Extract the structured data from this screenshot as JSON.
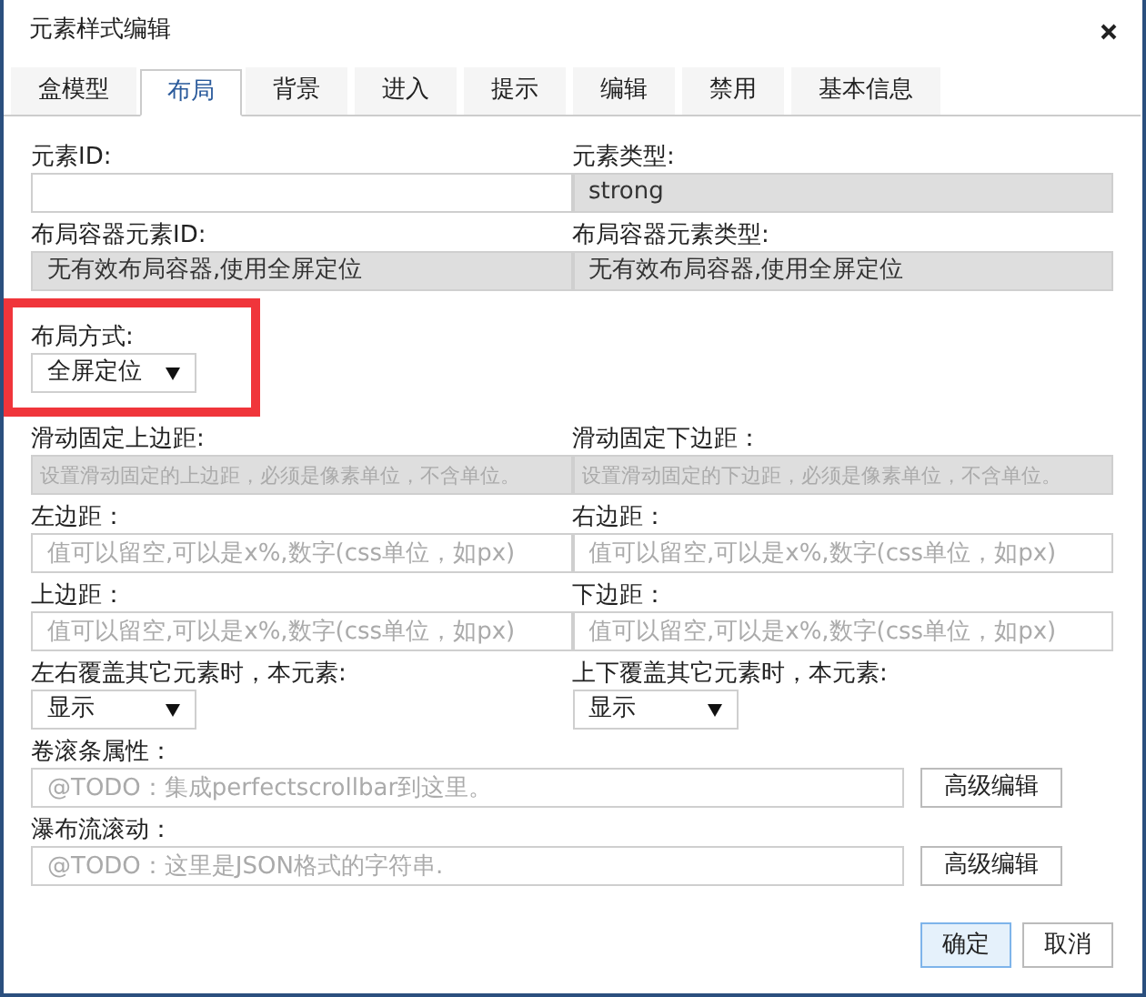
{
  "window": {
    "title": "元素样式编辑"
  },
  "tabs": [
    {
      "label": "盒模型",
      "selected": false
    },
    {
      "label": "布局",
      "selected": true
    },
    {
      "label": "背景",
      "selected": false
    },
    {
      "label": "进入",
      "selected": false
    },
    {
      "label": "提示",
      "selected": false
    },
    {
      "label": "编辑",
      "selected": false
    },
    {
      "label": "禁用",
      "selected": false
    },
    {
      "label": "基本信息",
      "selected": false
    }
  ],
  "rows": [
    {
      "kind": "pair",
      "cells": [
        {
          "label": "元素ID:",
          "kind": "input"
        },
        {
          "label": "元素类型:",
          "kind": "readonly",
          "value": "strong"
        }
      ]
    },
    {
      "kind": "pair",
      "cells": [
        {
          "label": "布局容器元素ID:",
          "kind": "readonly",
          "value": "无有效布局容器,使用全屏定位"
        },
        {
          "label": "布局容器元素类型:",
          "kind": "readonly",
          "value": "无有效布局容器,使用全屏定位"
        }
      ]
    },
    {
      "kind": "highlight",
      "cells": [
        {
          "label": "布局方式:",
          "kind": "select",
          "value": "全屏定位"
        }
      ]
    },
    {
      "kind": "pair",
      "cells": [
        {
          "label": "滑动固定上边距:",
          "kind": "disabled",
          "placeholder": "设置滑动固定的上边距，必须是像素单位，不含单位。"
        },
        {
          "label": "滑动固定下边距：",
          "kind": "disabled",
          "placeholder": "设置滑动固定的下边距，必须是像素单位，不含单位。"
        }
      ]
    },
    {
      "kind": "pair",
      "cells": [
        {
          "label": "左边距：",
          "kind": "input",
          "placeholder": "值可以留空,可以是x%,数字(css单位，如px)"
        },
        {
          "label": "右边距：",
          "kind": "input",
          "placeholder": "值可以留空,可以是x%,数字(css单位，如px)"
        }
      ]
    },
    {
      "kind": "pair",
      "cells": [
        {
          "label": "上边距：",
          "kind": "input",
          "placeholder": "值可以留空,可以是x%,数字(css单位，如px)"
        },
        {
          "label": "下边距：",
          "kind": "input",
          "placeholder": "值可以留空,可以是x%,数字(css单位，如px)"
        }
      ]
    },
    {
      "kind": "pair",
      "cells": [
        {
          "label": "左右覆盖其它元素时，本元素:",
          "kind": "select",
          "value": "显示"
        },
        {
          "label": "上下覆盖其它元素时，本元素:",
          "kind": "select",
          "value": "显示"
        }
      ]
    },
    {
      "kind": "wide",
      "cells": [
        {
          "label": "卷滚条属性：",
          "kind": "input",
          "placeholder": "@TODO：集成perfectscrollbar到这里。",
          "button": "高级编辑"
        }
      ]
    },
    {
      "kind": "wide",
      "cells": [
        {
          "label": "瀑布流滚动：",
          "kind": "input",
          "placeholder": "@TODO：这里是JSON格式的字符串.",
          "button": "高级编辑"
        }
      ]
    }
  ],
  "buttons": [
    {
      "label": "确定",
      "primary": true
    },
    {
      "label": "取消",
      "primary": false
    }
  ]
}
